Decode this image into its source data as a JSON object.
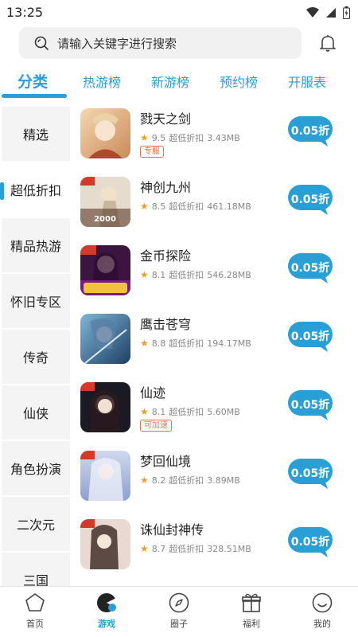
{
  "status": {
    "time": "13:25"
  },
  "search": {
    "placeholder": "请输入关键字进行搜索"
  },
  "tabs": [
    {
      "label": "分类",
      "active": true
    },
    {
      "label": "热游榜"
    },
    {
      "label": "新游榜"
    },
    {
      "label": "预约榜"
    },
    {
      "label": "开服表"
    }
  ],
  "sidebar": {
    "items": [
      {
        "label": "精选"
      },
      {
        "label": "超低折扣",
        "active": true
      },
      {
        "label": "精品热游"
      },
      {
        "label": "怀旧专区"
      },
      {
        "label": "传奇"
      },
      {
        "label": "仙侠"
      },
      {
        "label": "角色扮演"
      },
      {
        "label": "二次元"
      },
      {
        "label": "三国"
      }
    ]
  },
  "games": [
    {
      "name": "戮天之剑",
      "rating": "9.5",
      "desc": "超低折扣",
      "size": "3.43MB",
      "tag": "专服",
      "discount": "0.05折"
    },
    {
      "name": "神创九州",
      "rating": "8.5",
      "desc": "超低折扣",
      "size": "461.18MB",
      "tag": "",
      "discount": "0.05折"
    },
    {
      "name": "金币探险",
      "rating": "8.1",
      "desc": "超低折扣",
      "size": "546.28MB",
      "tag": "",
      "discount": "0.05折"
    },
    {
      "name": "鹰击苍穹",
      "rating": "8.8",
      "desc": "超低折扣",
      "size": "194.17MB",
      "tag": "",
      "discount": "0.05折"
    },
    {
      "name": "仙迹",
      "rating": "8.1",
      "desc": "超低折扣",
      "size": "5.60MB",
      "tag": "可加速",
      "discount": "0.05折"
    },
    {
      "name": "梦回仙境",
      "rating": "8.2",
      "desc": "超低折扣",
      "size": "3.89MB",
      "tag": "",
      "discount": "0.05折"
    },
    {
      "name": "诛仙封神传",
      "rating": "8.7",
      "desc": "超低折扣",
      "size": "328.51MB",
      "tag": "",
      "discount": "0.05折"
    }
  ],
  "bottom_nav": [
    {
      "label": "首页",
      "icon": "home-icon"
    },
    {
      "label": "游戏",
      "icon": "game-icon",
      "active": true
    },
    {
      "label": "圈子",
      "icon": "compass-icon"
    },
    {
      "label": "福利",
      "icon": "gift-icon"
    },
    {
      "label": "我的",
      "icon": "smile-icon"
    }
  ],
  "colors": {
    "accent": "#2a9fd6",
    "star": "#f0a020",
    "tag": "#e8734a"
  }
}
